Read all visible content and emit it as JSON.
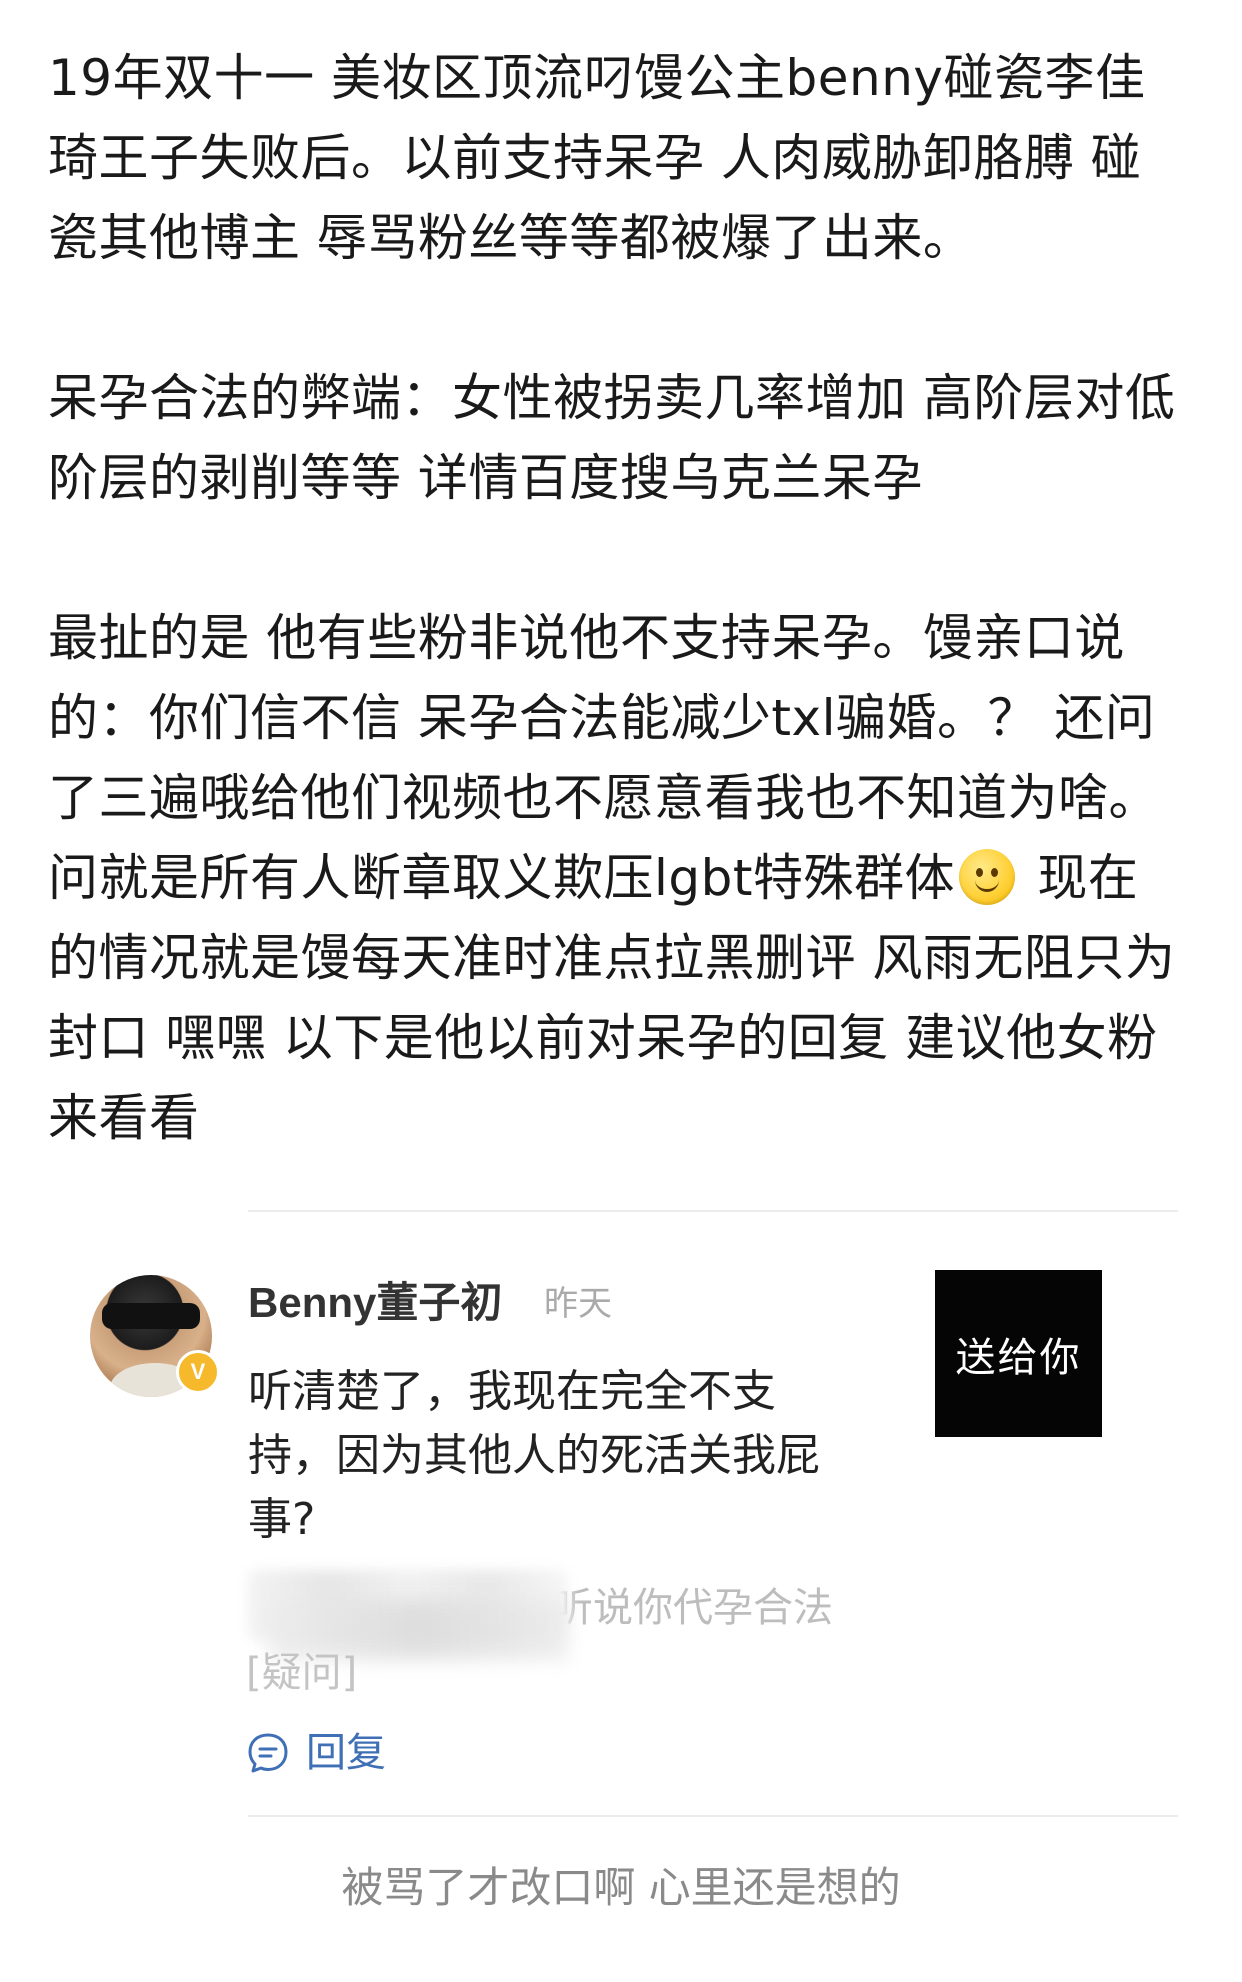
{
  "post": {
    "para1": "19年双十一 美妆区顶流叼馒公主benny碰瓷李佳琦王子失败后。以前支持呆孕 人肉威胁卸胳膊 碰瓷其他博主 辱骂粉丝等等都被爆了出来。",
    "para2": "呆孕合法的弊端：女性被拐卖几率增加 高阶层对低阶层的剥削等等 详情百度搜乌克兰呆孕",
    "para3_before_emoji": "最扯的是 他有些粉非说他不支持呆孕。馒亲口说的：你们信不信 呆孕合法能减少txl骗婚。？ 还问了三遍哦给他们视频也不愿意看我也不知道为啥。问就是所有人断章取义欺压lgbt特殊群体",
    "emoji": "slightly-smiling-face",
    "para3_after_emoji": " 现在的情况就是馒每天准时准点拉黑删评 风雨无阻只为封口 嘿嘿 以下是他以前对呆孕的回复 建议他女粉来看看"
  },
  "comment": {
    "username": "Benny董子初",
    "timestamp": "昨天",
    "verified_badge": "V",
    "text": "听清楚了，我现在完全不支持，因为其他人的死活关我屁事?",
    "quoted_visible": "听说你代孕合法",
    "quoted_tag": "[疑问]",
    "reply_label": "回复",
    "thumbnail_text": "送给你"
  },
  "caption": "被骂了才改口啊 心里还是想的",
  "colors": {
    "text": "#1a1a1a",
    "muted": "#aaaaaa",
    "link": "#3f6fb5",
    "badge": "#f6b92b",
    "divider": "#ececec"
  }
}
